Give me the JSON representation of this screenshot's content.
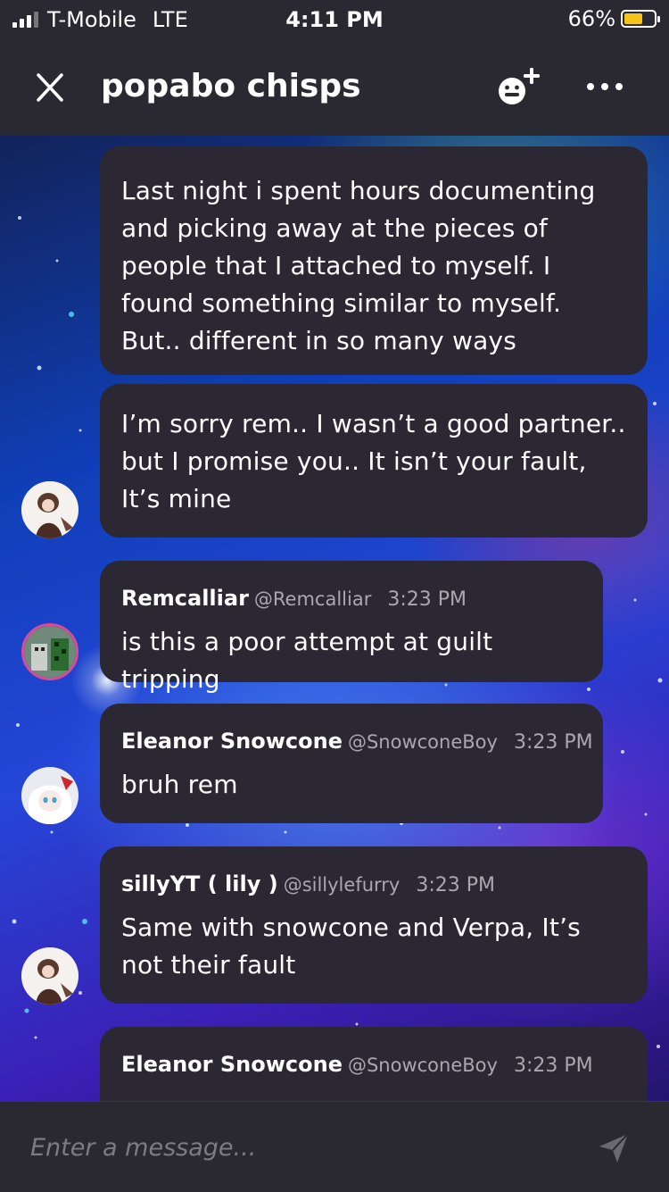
{
  "status_bar": {
    "carrier": "T-Mobile",
    "network": "LTE",
    "time": "4:11 PM",
    "battery_percent": "66%",
    "battery_level": 0.66
  },
  "header": {
    "title": "popabo chisps",
    "close_icon": "close-icon",
    "add_member_icon": "smiley-plus-icon",
    "more_icon": "more-horizontal-icon"
  },
  "messages": [
    {
      "text": "Last night i spent hours documenting and picking away at the pieces of people that I attached to myself. I found something similar to myself. But.. different in so many ways"
    },
    {
      "text": "I’m sorry rem.. I wasn’t a good partner.. but I promise you.. It isn’t your fault, It’s mine"
    },
    {
      "author": "Remcalliar",
      "handle": "@Remcalliar",
      "time": "3:23 PM",
      "text": "is this a poor attempt at guilt tripping"
    },
    {
      "author": "Eleanor Snowcone",
      "handle": "@SnowconeBoy",
      "time": "3:23 PM",
      "text": "bruh rem"
    },
    {
      "author": "sillyYT ( lily )",
      "handle": "@sillylefurry",
      "time": "3:23 PM",
      "text": "Same with snowcone and Verpa, It’s not their fault"
    },
    {
      "author": "Eleanor Snowcone",
      "handle": "@SnowconeBoy",
      "time": "3:23 PM"
    }
  ],
  "composer": {
    "placeholder": "Enter a message...",
    "send_icon": "send-icon"
  },
  "colors": {
    "bar_background": "#2a2830",
    "bubble_background": "#2b2833",
    "secondary_text": "#a9a8b0",
    "battery": "#f5c518"
  }
}
